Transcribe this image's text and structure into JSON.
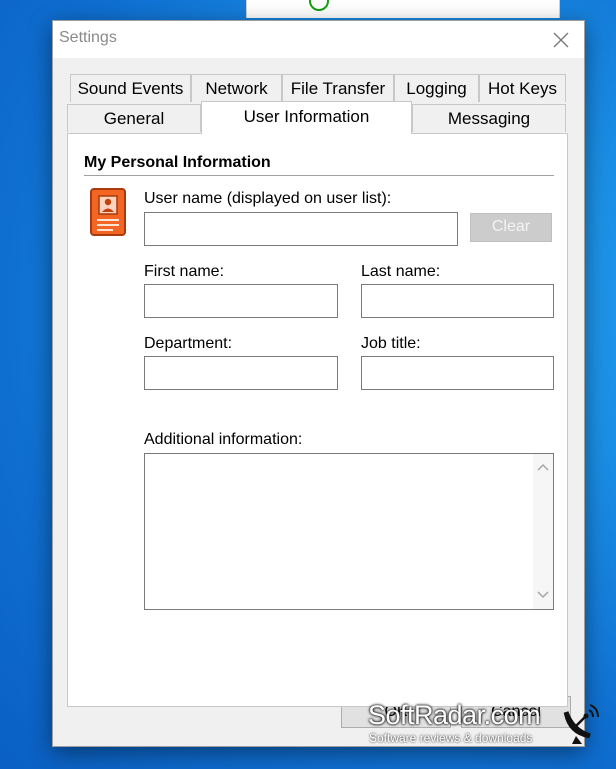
{
  "background_window": {},
  "dialog": {
    "title": "Settings",
    "tabs_row1": [
      {
        "label": "Sound Events"
      },
      {
        "label": "Network"
      },
      {
        "label": "File Transfer"
      },
      {
        "label": "Logging"
      },
      {
        "label": "Hot Keys"
      }
    ],
    "tabs_row2": [
      {
        "label": "General"
      },
      {
        "label": "User Information",
        "active": true
      },
      {
        "label": "Messaging"
      }
    ]
  },
  "panel": {
    "section_title": "My Personal Information",
    "icon": "contact-card-icon",
    "user_name_label": "User name (displayed on user list):",
    "user_name_value": "",
    "clear_label": "Clear",
    "first_name_label": "First name:",
    "first_name_value": "",
    "last_name_label": "Last name:",
    "last_name_value": "",
    "department_label": "Department:",
    "department_value": "",
    "job_title_label": "Job title:",
    "job_title_value": "",
    "additional_label": "Additional information:",
    "additional_value": ""
  },
  "buttons": {
    "ok_label": "OK",
    "cancel_label": "Cancel"
  },
  "watermark": {
    "brand": "SoftRadar.com",
    "tagline": "Software reviews & downloads"
  },
  "colors": {
    "desktop": "#1b8fe6",
    "icon_orange": "#e8581c",
    "clear_disabled": "#cccccc"
  }
}
